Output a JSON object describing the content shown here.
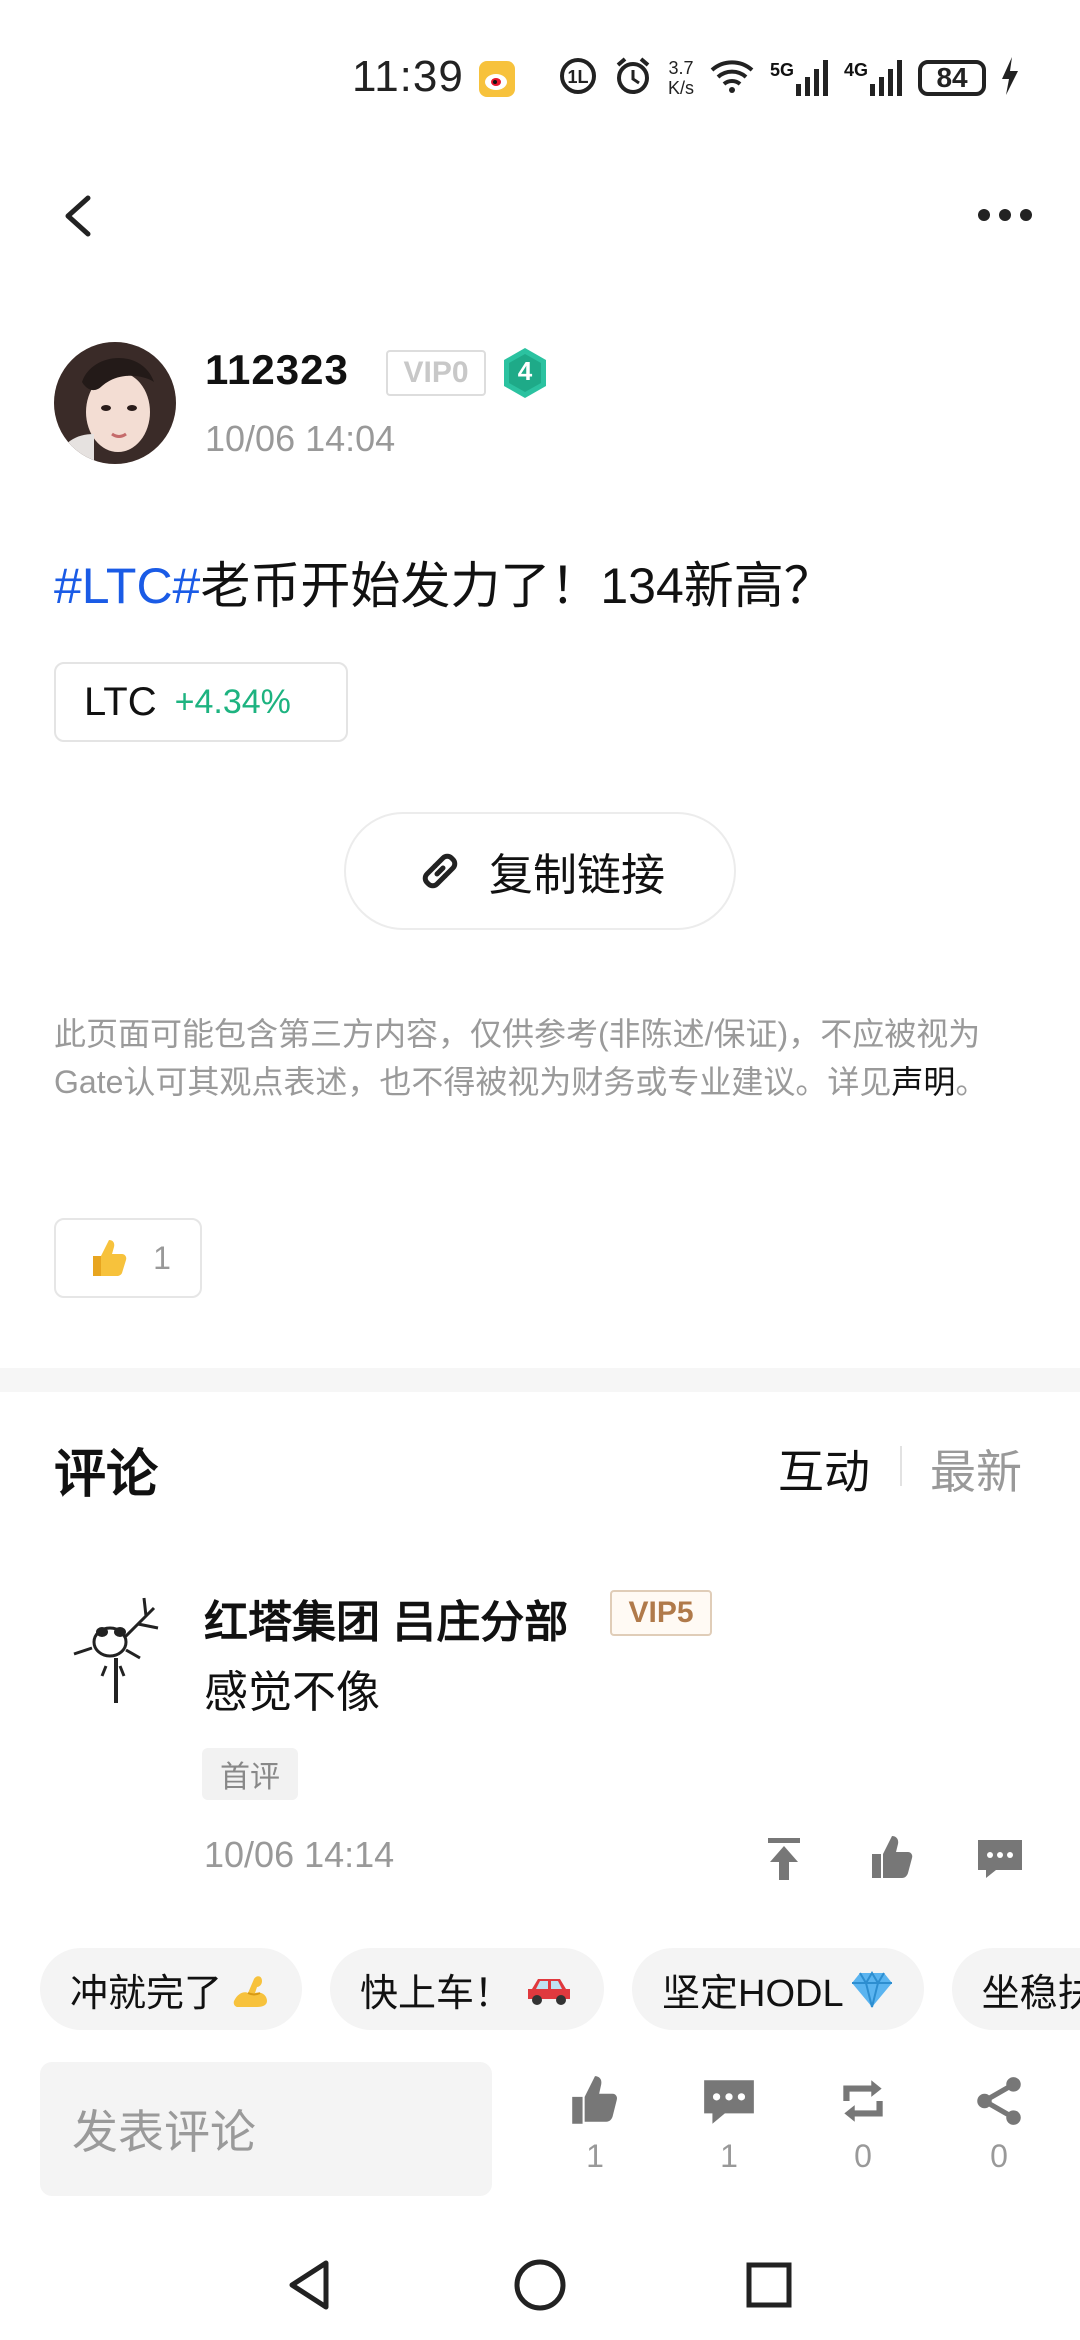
{
  "status_bar": {
    "time": "11:39",
    "net_speed_value": "3.7",
    "net_speed_unit": "K/s",
    "signal_5g": "5G",
    "signal_4g": "4G",
    "battery": "84"
  },
  "header": {
    "back_icon": "chevron-left-icon",
    "more_icon": "more-dots-icon"
  },
  "post": {
    "author": "112323",
    "vip": "VIP0",
    "level": "4",
    "time": "10/06 14:04",
    "tag": "#LTC#",
    "body": "老币开始发力了！134新高？",
    "ticker": {
      "symbol": "LTC",
      "change": "+4.34%"
    },
    "copy_link": "复制链接",
    "disclaimer": "此页面可能包含第三方内容，仅供参考(非陈述/保证)，不应被视为Gate认可其观点表述，也不得被视为财务或专业建议。详见",
    "disclaimer_link": "声明",
    "disclaimer_end": "。",
    "likes": "1"
  },
  "comments": {
    "title": "评论",
    "sort_hot": "互动",
    "sort_new": "最新",
    "items": [
      {
        "user": "红塔集团 吕庄分部",
        "vip": "VIP5",
        "text": "感觉不像",
        "badge": "首评",
        "time": "10/06 14:14"
      }
    ]
  },
  "quick_replies": [
    {
      "label": "冲就完了",
      "emoji": "flexed-biceps-icon"
    },
    {
      "label": "快上车！",
      "emoji": "car-icon"
    },
    {
      "label": "坚定HODL",
      "emoji": "gem-icon"
    },
    {
      "label": "坐稳扶",
      "emoji": ""
    }
  ],
  "bottom_bar": {
    "input_placeholder": "发表评论",
    "likes": "1",
    "comments": "1",
    "reposts": "0",
    "shares": "0"
  },
  "colors": {
    "accent_blue": "#1a5be6",
    "positive_green": "#1db380",
    "muted": "#999999"
  }
}
